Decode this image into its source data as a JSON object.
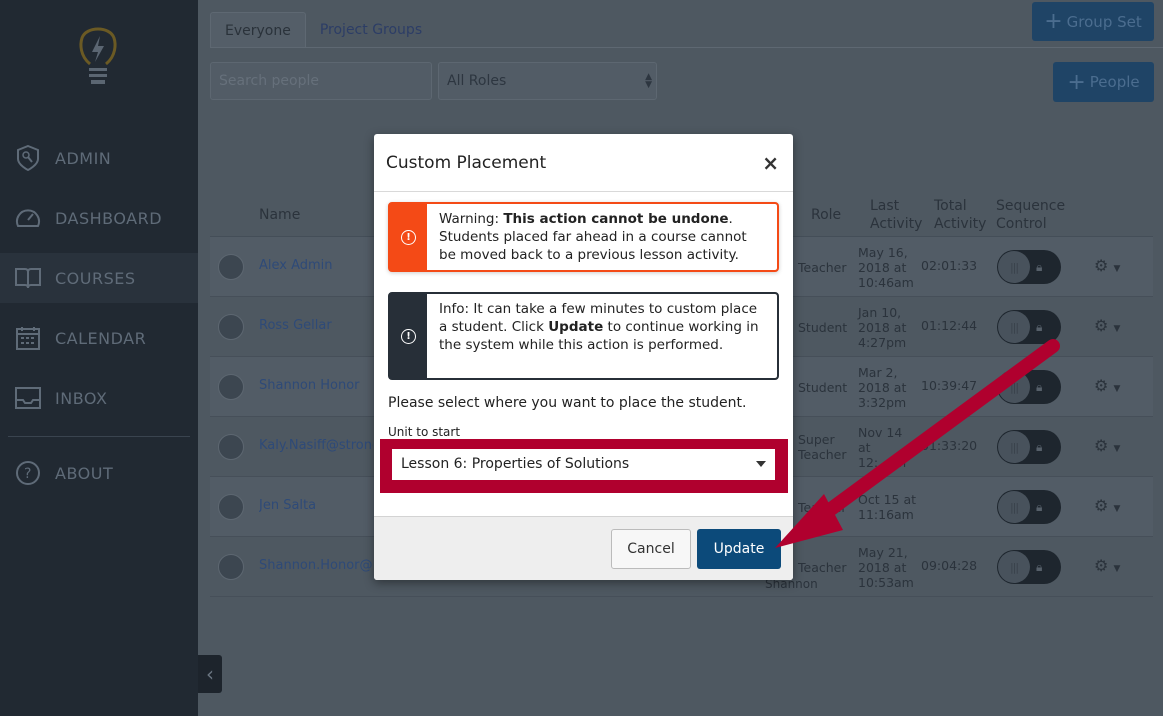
{
  "sidebar": {
    "items": [
      {
        "label": "ADMIN",
        "icon": "shield-key-icon"
      },
      {
        "label": "DASHBOARD",
        "icon": "speedometer-icon"
      },
      {
        "label": "COURSES",
        "icon": "book-icon",
        "active": true
      },
      {
        "label": "CALENDAR",
        "icon": "calendar-icon"
      },
      {
        "label": "INBOX",
        "icon": "inbox-icon"
      },
      {
        "label": "ABOUT",
        "icon": "help-icon"
      }
    ]
  },
  "tabs": [
    {
      "label": "Everyone",
      "active": true
    },
    {
      "label": "Project Groups"
    }
  ],
  "buttons": {
    "group_set": "Group Set",
    "people": "People"
  },
  "search": {
    "placeholder": "Search people"
  },
  "roles_select": {
    "value": "All Roles"
  },
  "table": {
    "headers": {
      "name": "Name",
      "role": "Role",
      "last": "Last Activity",
      "total": "Total Activity",
      "seq": "Sequence Control"
    },
    "rows": [
      {
        "name": "Alex Admin",
        "role": "Teacher",
        "last": "May 16, 2018 at 10:46am",
        "total": "02:01:33"
      },
      {
        "name": "Ross Gellar",
        "role": "Student",
        "last": "Jan 10, 2018 at 4:27pm",
        "total": "01:12:44"
      },
      {
        "name": "Shannon Honor",
        "role": "Student",
        "last": "Mar 2, 2018 at 3:32pm",
        "total": "10:39:47"
      },
      {
        "name": "Kaly.Nasiff@strongmind.com",
        "role": "Super Teacher",
        "last": "Nov 14 at 12:..pm",
        "total": "01:33:20"
      },
      {
        "name": "Jen Salta",
        "role": "Teacher",
        "last": "Oct 15 at 11:16am",
        "total": ""
      },
      {
        "name": "Shannon.Honor@strongmind.com",
        "role": "Teacher",
        "last": "May 21, 2018 at 10:53am",
        "total": "09:04:28",
        "extra": "Shannon"
      }
    ]
  },
  "modal": {
    "title": "Custom Placement",
    "warning": {
      "prefix": "Warning: ",
      "bold": "This action cannot be undone",
      "suffix": ". Students placed far ahead in a course cannot be moved back to a previous lesson activity."
    },
    "info": {
      "prefix": "Info: It can take a few minutes to custom place a student. Click ",
      "bold": "Update",
      "suffix": " to continue working in the system while this action is performed."
    },
    "prompt": "Please select where you want to place the student.",
    "unit_label": "Unit to start",
    "unit_value": "Lesson 6: Properties of Solutions",
    "cancel": "Cancel",
    "update": "Update"
  },
  "colors": {
    "highlight": "#b0002e",
    "primary": "#0c4a7a",
    "warning": "#f44a16"
  }
}
